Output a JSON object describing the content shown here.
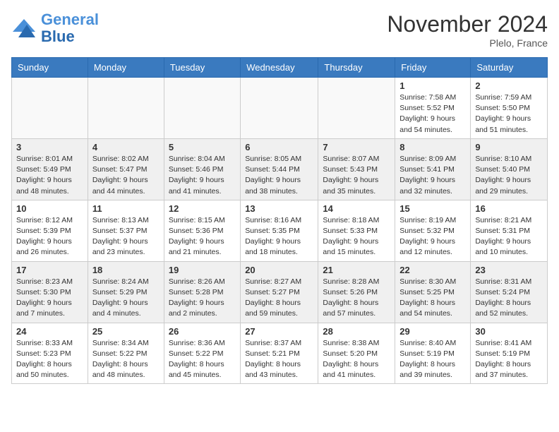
{
  "logo": {
    "line1": "General",
    "line2": "Blue"
  },
  "title": "November 2024",
  "location": "Plelo, France",
  "weekdays": [
    "Sunday",
    "Monday",
    "Tuesday",
    "Wednesday",
    "Thursday",
    "Friday",
    "Saturday"
  ],
  "weeks": [
    [
      {
        "day": "",
        "detail": ""
      },
      {
        "day": "",
        "detail": ""
      },
      {
        "day": "",
        "detail": ""
      },
      {
        "day": "",
        "detail": ""
      },
      {
        "day": "",
        "detail": ""
      },
      {
        "day": "1",
        "detail": "Sunrise: 7:58 AM\nSunset: 5:52 PM\nDaylight: 9 hours and 54 minutes."
      },
      {
        "day": "2",
        "detail": "Sunrise: 7:59 AM\nSunset: 5:50 PM\nDaylight: 9 hours and 51 minutes."
      }
    ],
    [
      {
        "day": "3",
        "detail": "Sunrise: 8:01 AM\nSunset: 5:49 PM\nDaylight: 9 hours and 48 minutes."
      },
      {
        "day": "4",
        "detail": "Sunrise: 8:02 AM\nSunset: 5:47 PM\nDaylight: 9 hours and 44 minutes."
      },
      {
        "day": "5",
        "detail": "Sunrise: 8:04 AM\nSunset: 5:46 PM\nDaylight: 9 hours and 41 minutes."
      },
      {
        "day": "6",
        "detail": "Sunrise: 8:05 AM\nSunset: 5:44 PM\nDaylight: 9 hours and 38 minutes."
      },
      {
        "day": "7",
        "detail": "Sunrise: 8:07 AM\nSunset: 5:43 PM\nDaylight: 9 hours and 35 minutes."
      },
      {
        "day": "8",
        "detail": "Sunrise: 8:09 AM\nSunset: 5:41 PM\nDaylight: 9 hours and 32 minutes."
      },
      {
        "day": "9",
        "detail": "Sunrise: 8:10 AM\nSunset: 5:40 PM\nDaylight: 9 hours and 29 minutes."
      }
    ],
    [
      {
        "day": "10",
        "detail": "Sunrise: 8:12 AM\nSunset: 5:39 PM\nDaylight: 9 hours and 26 minutes."
      },
      {
        "day": "11",
        "detail": "Sunrise: 8:13 AM\nSunset: 5:37 PM\nDaylight: 9 hours and 23 minutes."
      },
      {
        "day": "12",
        "detail": "Sunrise: 8:15 AM\nSunset: 5:36 PM\nDaylight: 9 hours and 21 minutes."
      },
      {
        "day": "13",
        "detail": "Sunrise: 8:16 AM\nSunset: 5:35 PM\nDaylight: 9 hours and 18 minutes."
      },
      {
        "day": "14",
        "detail": "Sunrise: 8:18 AM\nSunset: 5:33 PM\nDaylight: 9 hours and 15 minutes."
      },
      {
        "day": "15",
        "detail": "Sunrise: 8:19 AM\nSunset: 5:32 PM\nDaylight: 9 hours and 12 minutes."
      },
      {
        "day": "16",
        "detail": "Sunrise: 8:21 AM\nSunset: 5:31 PM\nDaylight: 9 hours and 10 minutes."
      }
    ],
    [
      {
        "day": "17",
        "detail": "Sunrise: 8:23 AM\nSunset: 5:30 PM\nDaylight: 9 hours and 7 minutes."
      },
      {
        "day": "18",
        "detail": "Sunrise: 8:24 AM\nSunset: 5:29 PM\nDaylight: 9 hours and 4 minutes."
      },
      {
        "day": "19",
        "detail": "Sunrise: 8:26 AM\nSunset: 5:28 PM\nDaylight: 9 hours and 2 minutes."
      },
      {
        "day": "20",
        "detail": "Sunrise: 8:27 AM\nSunset: 5:27 PM\nDaylight: 8 hours and 59 minutes."
      },
      {
        "day": "21",
        "detail": "Sunrise: 8:28 AM\nSunset: 5:26 PM\nDaylight: 8 hours and 57 minutes."
      },
      {
        "day": "22",
        "detail": "Sunrise: 8:30 AM\nSunset: 5:25 PM\nDaylight: 8 hours and 54 minutes."
      },
      {
        "day": "23",
        "detail": "Sunrise: 8:31 AM\nSunset: 5:24 PM\nDaylight: 8 hours and 52 minutes."
      }
    ],
    [
      {
        "day": "24",
        "detail": "Sunrise: 8:33 AM\nSunset: 5:23 PM\nDaylight: 8 hours and 50 minutes."
      },
      {
        "day": "25",
        "detail": "Sunrise: 8:34 AM\nSunset: 5:22 PM\nDaylight: 8 hours and 48 minutes."
      },
      {
        "day": "26",
        "detail": "Sunrise: 8:36 AM\nSunset: 5:22 PM\nDaylight: 8 hours and 45 minutes."
      },
      {
        "day": "27",
        "detail": "Sunrise: 8:37 AM\nSunset: 5:21 PM\nDaylight: 8 hours and 43 minutes."
      },
      {
        "day": "28",
        "detail": "Sunrise: 8:38 AM\nSunset: 5:20 PM\nDaylight: 8 hours and 41 minutes."
      },
      {
        "day": "29",
        "detail": "Sunrise: 8:40 AM\nSunset: 5:19 PM\nDaylight: 8 hours and 39 minutes."
      },
      {
        "day": "30",
        "detail": "Sunrise: 8:41 AM\nSunset: 5:19 PM\nDaylight: 8 hours and 37 minutes."
      }
    ]
  ]
}
